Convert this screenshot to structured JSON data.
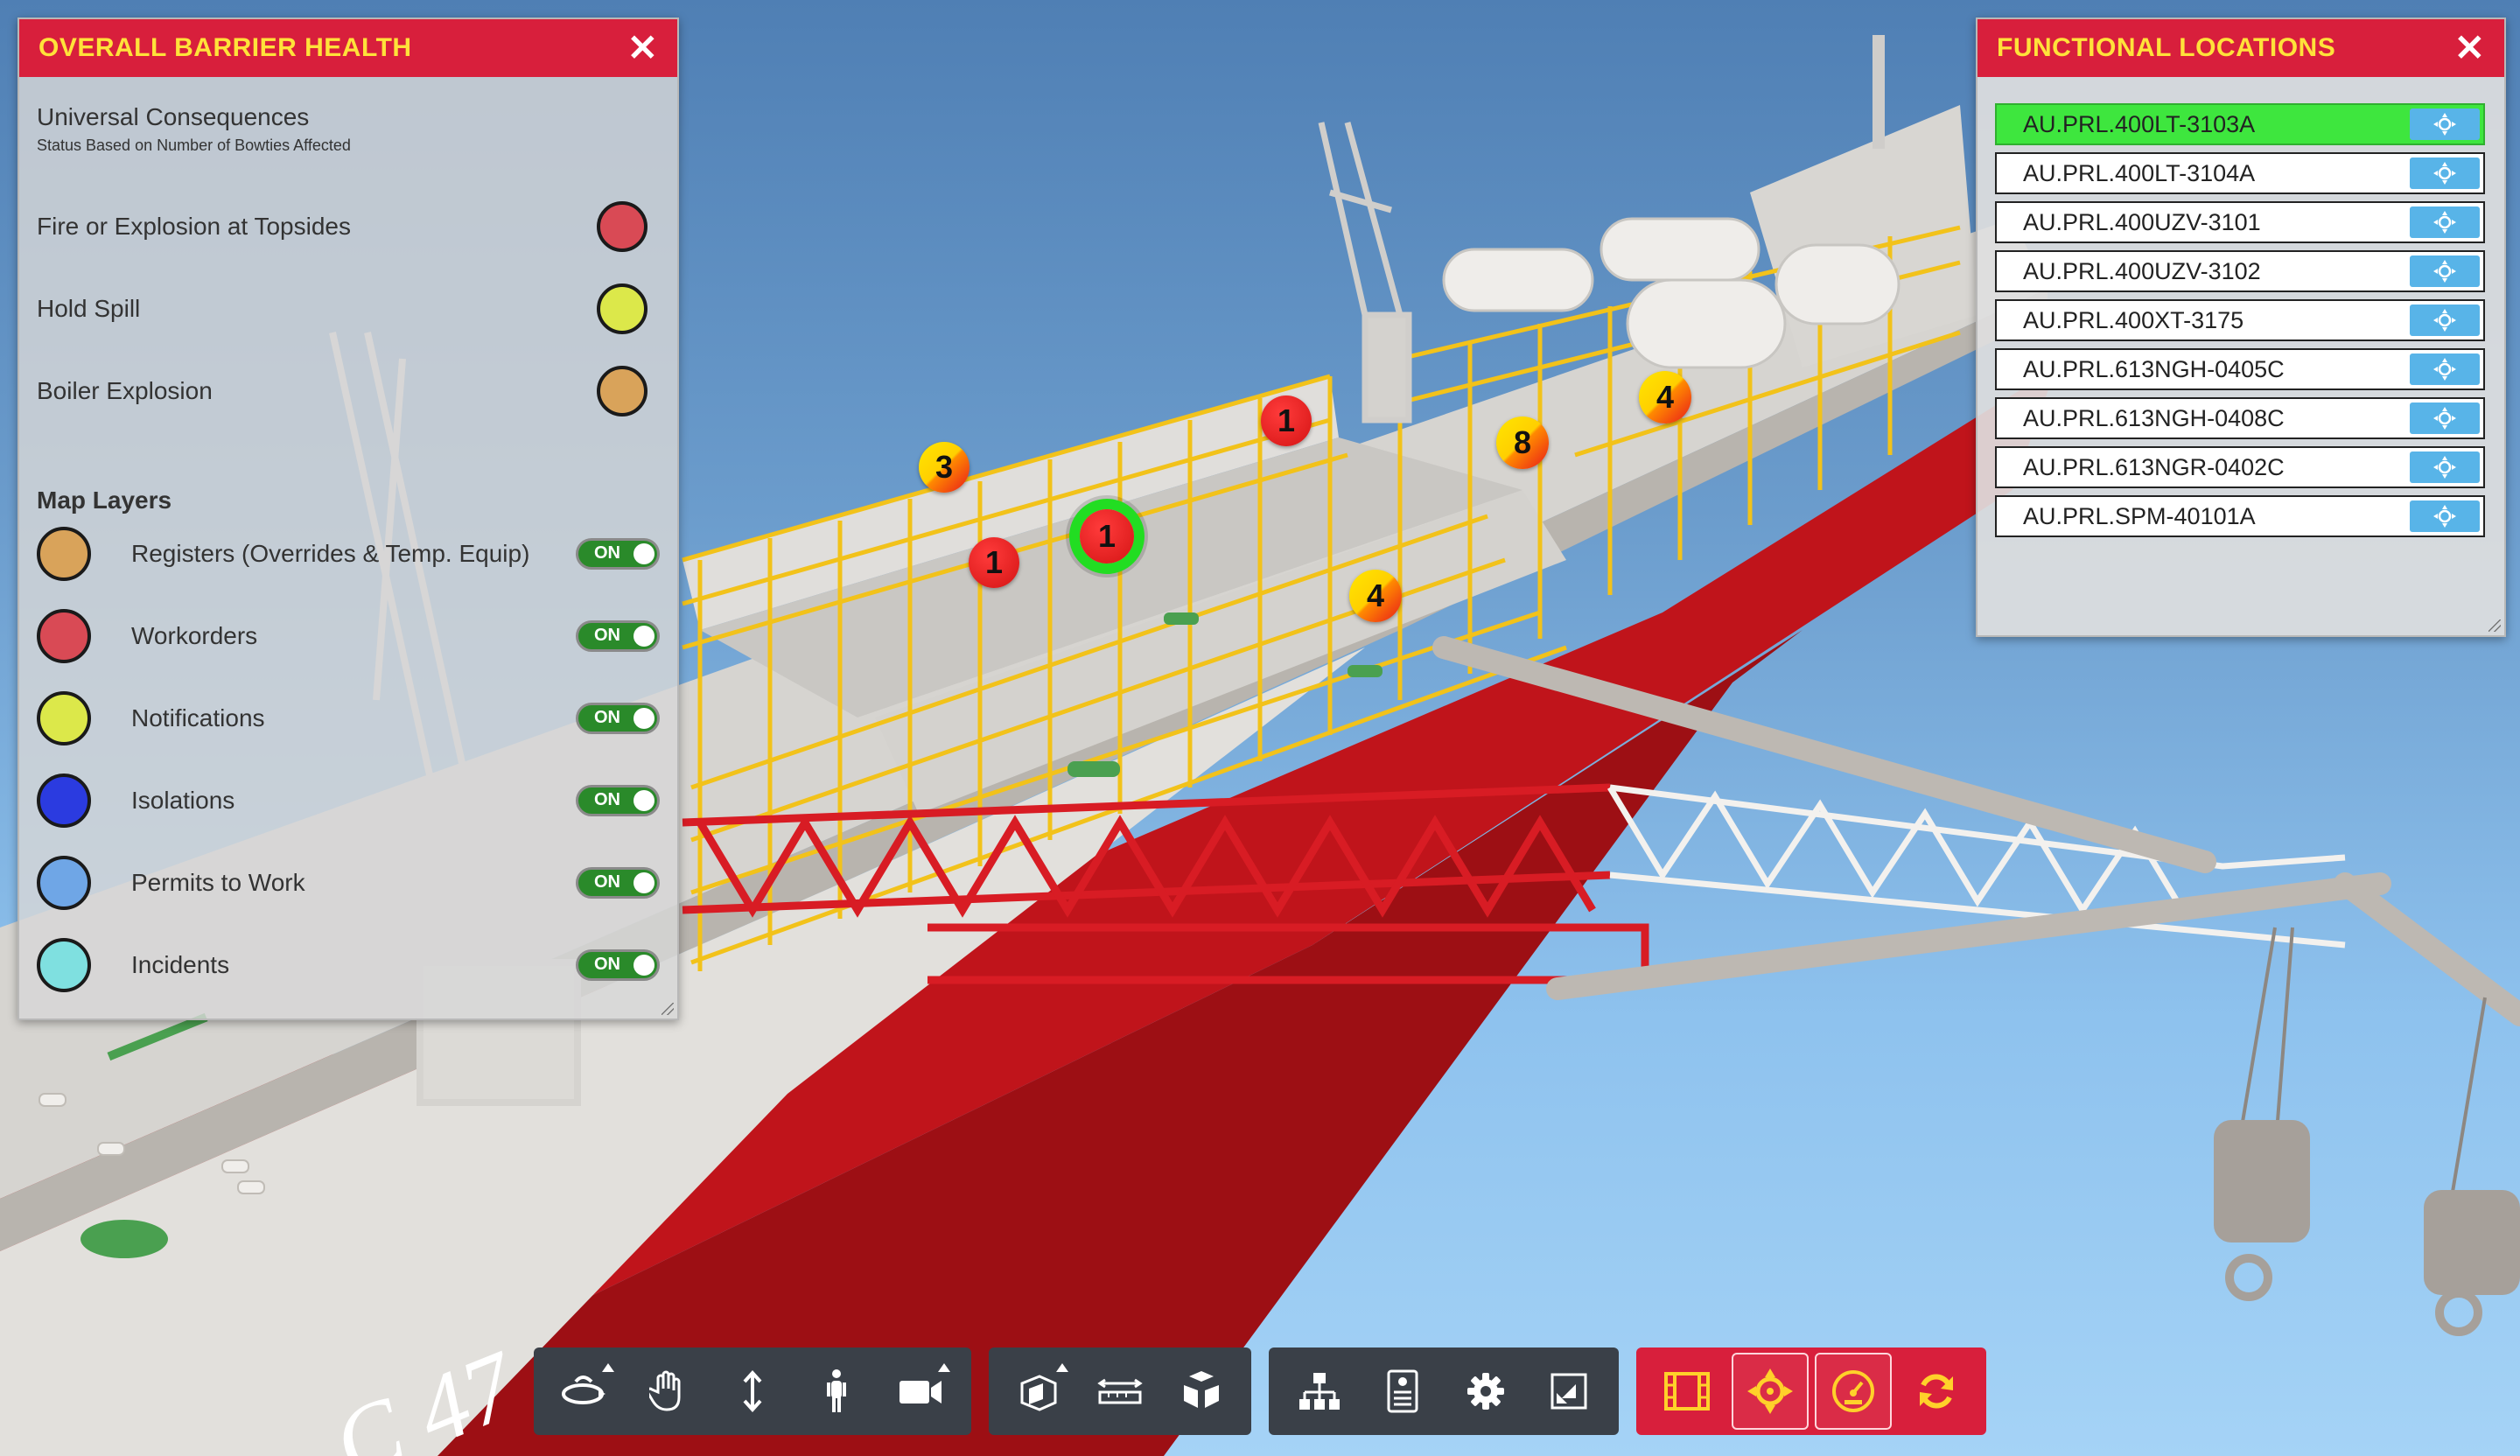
{
  "colors": {
    "panel_header": "#d81f3c",
    "panel_title": "#ffe23a",
    "red": "#d94a55",
    "yellow": "#dce84a",
    "orange": "#d9a35a",
    "blue": "#2b3be0",
    "light_blue": "#6fa6e6",
    "cyan": "#7fe0e0",
    "active_location": "#3ee63e"
  },
  "barrier_panel": {
    "title": "OVERALL BARRIER HEALTH",
    "close_icon": "close-icon",
    "section_title": "Universal Consequences",
    "section_subtitle": "Status Based on Number of Bowties Affected",
    "consequences": [
      {
        "label": "Fire or Explosion at Topsides",
        "color": "#d94a55"
      },
      {
        "label": "Hold Spill",
        "color": "#dce84a"
      },
      {
        "label": "Boiler Explosion",
        "color": "#d9a35a"
      }
    ],
    "layers_title": "Map Layers",
    "layers": [
      {
        "label": "Registers (Overrides & Temp. Equip)",
        "color": "#d9a35a",
        "toggle": "ON"
      },
      {
        "label": "Workorders",
        "color": "#d94a55",
        "toggle": "ON"
      },
      {
        "label": "Notifications",
        "color": "#dce84a",
        "toggle": "ON"
      },
      {
        "label": "Isolations",
        "color": "#2b3be0",
        "toggle": "ON"
      },
      {
        "label": "Permits to Work",
        "color": "#6fa6e6",
        "toggle": "ON"
      },
      {
        "label": "Incidents",
        "color": "#7fe0e0",
        "toggle": "ON"
      }
    ]
  },
  "locations_panel": {
    "title": "FUNCTIONAL LOCATIONS",
    "close_icon": "close-icon",
    "items": [
      {
        "label": "AU.PRL.400LT-3103A",
        "active": true
      },
      {
        "label": "AU.PRL.400LT-3104A",
        "active": false
      },
      {
        "label": "AU.PRL.400UZV-3101",
        "active": false
      },
      {
        "label": "AU.PRL.400UZV-3102",
        "active": false
      },
      {
        "label": "AU.PRL.400XT-3175",
        "active": false
      },
      {
        "label": "AU.PRL.613NGH-0405C",
        "active": false
      },
      {
        "label": "AU.PRL.613NGH-0408C",
        "active": false
      },
      {
        "label": "AU.PRL.613NGR-0402C",
        "active": false
      },
      {
        "label": "AU.PRL.SPM-40101A",
        "active": false
      }
    ],
    "item_button_icon": "locate-icon"
  },
  "scene": {
    "hull_text": "C 47",
    "markers": [
      {
        "label": "3",
        "style": "yellow-red"
      },
      {
        "label": "1",
        "style": "red"
      },
      {
        "label": "1",
        "style": "red"
      },
      {
        "label": "1",
        "style": "red-selected"
      },
      {
        "label": "8",
        "style": "yellow-red"
      },
      {
        "label": "4",
        "style": "yellow-red"
      },
      {
        "label": "4",
        "style": "yellow-red"
      }
    ]
  },
  "toolbar": {
    "navigation": [
      "orbit-icon",
      "pan-hand-icon",
      "vertical-move-icon",
      "walk-person-icon",
      "camera-icon"
    ],
    "tools": [
      "section-box-icon",
      "measure-icon",
      "explode-model-icon"
    ],
    "views": [
      "model-tree-icon",
      "properties-icon",
      "settings-gear-icon",
      "fullscreen-icon"
    ],
    "actions": [
      "film-strip-icon",
      "locate-target-icon",
      "dashboard-gauge-icon",
      "refresh-icon"
    ]
  }
}
